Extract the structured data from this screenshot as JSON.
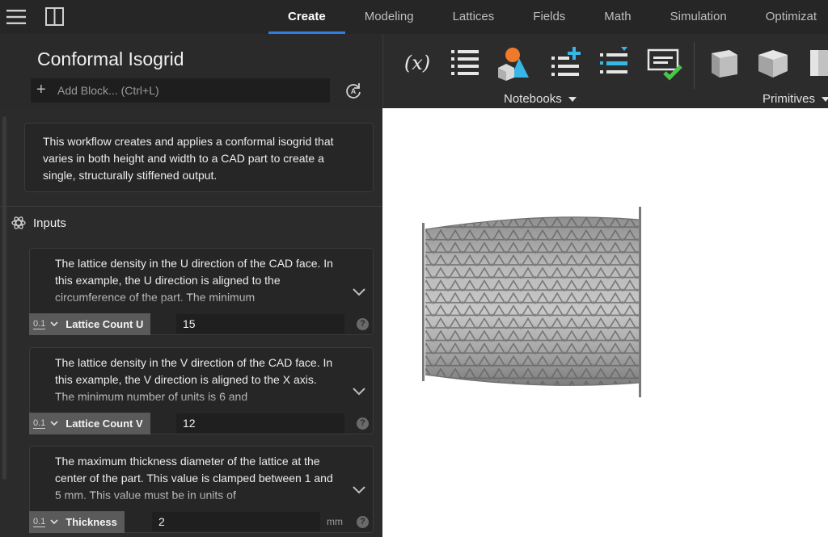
{
  "topbar": {
    "tabs": [
      {
        "label": "Create",
        "active": true
      },
      {
        "label": "Modeling",
        "active": false
      },
      {
        "label": "Lattices",
        "active": false
      },
      {
        "label": "Fields",
        "active": false
      },
      {
        "label": "Math",
        "active": false
      },
      {
        "label": "Simulation",
        "active": false
      },
      {
        "label": "Optimizat",
        "active": false
      }
    ],
    "accent": "#2f7fe0"
  },
  "notebook": {
    "title": "Conformal Isogrid",
    "add_block_placeholder": "Add Block... (Ctrl+L)",
    "description": "This workflow creates and applies a conformal isogrid that varies in both height and width to a CAD part to create a single, structurally stiffened output."
  },
  "toolbar": {
    "groups": [
      {
        "label": "Notebooks",
        "icons": [
          "variable-icon",
          "list-icon",
          "shapes-icon",
          "add-list-item-icon",
          "insert-list-item-icon",
          "checkmark-list-icon"
        ]
      },
      {
        "label": "Primitives",
        "icons": [
          "cube-icon",
          "box-icon",
          "cylinder-icon"
        ]
      }
    ]
  },
  "inputs": {
    "heading": "Inputs",
    "params": [
      {
        "description": "The lattice density in the U direction of the CAD face. In this example, the U direction is aligned to the circumference of the part. The minimum",
        "type_label": "0.1",
        "name": "Lattice Count U",
        "value": "15",
        "unit": ""
      },
      {
        "description": "The lattice density in the V direction of the CAD face. In this example, the V direction is aligned to the X axis. The minimum number of units is 6 and",
        "type_label": "0.1",
        "name": "Lattice Count V",
        "value": "12",
        "unit": ""
      },
      {
        "description": "The maximum thickness diameter of the lattice at the center of the part. This value is clamped between 1 and 5 mm. This value must be in units of",
        "type_label": "0.1",
        "name": "Thickness",
        "value": "2",
        "unit": "mm"
      }
    ]
  },
  "help_glyph": "?"
}
